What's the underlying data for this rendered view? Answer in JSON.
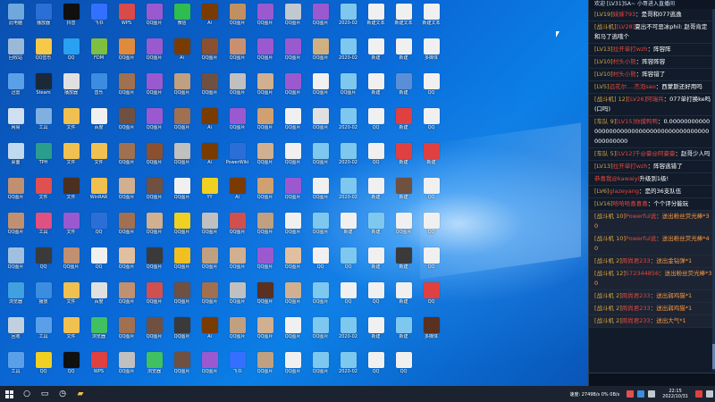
{
  "desktop": {
    "icons": [
      {
        "label": "此电脑",
        "color": "#6fa8dc"
      },
      {
        "label": "播放器",
        "color": "#2b6fd6"
      },
      {
        "label": "抖音",
        "color": "#101010"
      },
      {
        "label": "飞书",
        "color": "#3370ff"
      },
      {
        "label": "WPS",
        "color": "#d94a4a"
      },
      {
        "label": "QQ图片",
        "color": "#9b59d0"
      },
      {
        "label": "微信",
        "color": "#2ebd4e"
      },
      {
        "label": "Ai",
        "color": "#7a3b00"
      },
      {
        "label": "QQ图片",
        "color": "#c09060"
      },
      {
        "label": "QQ图片",
        "color": "#9b59d0"
      },
      {
        "label": "QQ图片",
        "color": "#c0c8d0"
      },
      {
        "label": "QQ图片",
        "color": "#9b59d0"
      },
      {
        "label": "2020-02",
        "color": "#7ec8f0"
      },
      {
        "label": "新建文本",
        "color": "#f0f0f0"
      },
      {
        "label": "新建文本",
        "color": "#f0f0f0"
      },
      {
        "label": "新建文本",
        "color": "#f0f0f0"
      },
      {
        "label": "",
        "color": "#0a6ad8"
      },
      {
        "label": "回收站",
        "color": "#9ab8d8"
      },
      {
        "label": "QQ音乐",
        "color": "#f7c948"
      },
      {
        "label": "QQ",
        "color": "#2aa1f0"
      },
      {
        "label": "FDM",
        "color": "#7fbf3f"
      },
      {
        "label": "QQ图片",
        "color": "#e08a3c"
      },
      {
        "label": "QQ图片",
        "color": "#9b59d0"
      },
      {
        "label": "Ai",
        "color": "#7a3b00"
      },
      {
        "label": "QQ图片",
        "color": "#8a5030"
      },
      {
        "label": "QQ图片",
        "color": "#c89070"
      },
      {
        "label": "QQ图片",
        "color": "#9b59d0"
      },
      {
        "label": "QQ图片",
        "color": "#9b59d0"
      },
      {
        "label": "QQ图片",
        "color": "#d0b080"
      },
      {
        "label": "2020-02",
        "color": "#7ec8f0"
      },
      {
        "label": "新建",
        "color": "#f0f0f0"
      },
      {
        "label": "新建",
        "color": "#f0f0f0"
      },
      {
        "label": "多媒体",
        "color": "#f0f0f0"
      },
      {
        "label": "",
        "color": "#0a6ad8"
      },
      {
        "label": "迅雷",
        "color": "#5aa0e8"
      },
      {
        "label": "Steam",
        "color": "#1b2838"
      },
      {
        "label": "播放器",
        "color": "#e0e0e0"
      },
      {
        "label": "音乐",
        "color": "#3a8de0"
      },
      {
        "label": "QQ图片",
        "color": "#a07050"
      },
      {
        "label": "QQ图片",
        "color": "#9b59d0"
      },
      {
        "label": "QQ图片",
        "color": "#c0a080"
      },
      {
        "label": "QQ图片",
        "color": "#705040"
      },
      {
        "label": "QQ图片",
        "color": "#c0c0c0"
      },
      {
        "label": "QQ图片",
        "color": "#d0b090"
      },
      {
        "label": "QQ图片",
        "color": "#9b59d0"
      },
      {
        "label": "QQ图片",
        "color": "#f0f0f0"
      },
      {
        "label": "QQ图片",
        "color": "#7ec8f0"
      },
      {
        "label": "新建",
        "color": "#f0f0f0"
      },
      {
        "label": "新建",
        "color": "#5a8fd8"
      },
      {
        "label": "QQ",
        "color": "#f0f0f0"
      },
      {
        "label": "",
        "color": "#0a6ad8"
      },
      {
        "label": "网易",
        "color": "#d0e0f0"
      },
      {
        "label": "工具",
        "color": "#7fb0e0"
      },
      {
        "label": "文件",
        "color": "#f0c050"
      },
      {
        "label": "百度",
        "color": "#f0f0f0"
      },
      {
        "label": "QQ图片",
        "color": "#705040"
      },
      {
        "label": "QQ图片",
        "color": "#9b59d0"
      },
      {
        "label": "QQ图片",
        "color": "#a07050"
      },
      {
        "label": "Ai",
        "color": "#7a3b00"
      },
      {
        "label": "QQ图片",
        "color": "#9b59d0"
      },
      {
        "label": "QQ图片",
        "color": "#d0a070"
      },
      {
        "label": "QQ图片",
        "color": "#f0f0f0"
      },
      {
        "label": "QQ图片",
        "color": "#e0e0e0"
      },
      {
        "label": "2020-02",
        "color": "#7ec8f0"
      },
      {
        "label": "QQ",
        "color": "#f0f0f0"
      },
      {
        "label": "新建",
        "color": "#e04040"
      },
      {
        "label": "QQ",
        "color": "#f0f0f0"
      },
      {
        "label": "",
        "color": "#0a6ad8"
      },
      {
        "label": "桌面",
        "color": "#c0d8f0"
      },
      {
        "label": "TPH",
        "color": "#2a9d8f"
      },
      {
        "label": "文件",
        "color": "#f0c050"
      },
      {
        "label": "文件",
        "color": "#f0c050"
      },
      {
        "label": "QQ图片",
        "color": "#a07050"
      },
      {
        "label": "QQ图片",
        "color": "#8a5030"
      },
      {
        "label": "QQ图片",
        "color": "#c0c0c0"
      },
      {
        "label": "Ai",
        "color": "#7a3b00"
      },
      {
        "label": "PowerWiki",
        "color": "#2b6fd6"
      },
      {
        "label": "QQ图片",
        "color": "#d0b090"
      },
      {
        "label": "QQ图片",
        "color": "#f0f0f0"
      },
      {
        "label": "QQ图片",
        "color": "#7ec8f0"
      },
      {
        "label": "2020-02",
        "color": "#7ec8f0"
      },
      {
        "label": "QQ",
        "color": "#f0f0f0"
      },
      {
        "label": "新建",
        "color": "#e04040"
      },
      {
        "label": "新建",
        "color": "#e04040"
      },
      {
        "label": "",
        "color": "#0a6ad8"
      },
      {
        "label": "QQ图片",
        "color": "#c09070"
      },
      {
        "label": "文件",
        "color": "#e05050"
      },
      {
        "label": "文件",
        "color": "#4a3020"
      },
      {
        "label": "WinRAR",
        "color": "#f0c050"
      },
      {
        "label": "QQ图片",
        "color": "#d0b090"
      },
      {
        "label": "QQ图片",
        "color": "#705040"
      },
      {
        "label": "QQ图片",
        "color": "#f0f0f0"
      },
      {
        "label": "YY",
        "color": "#f0d020"
      },
      {
        "label": "Ai",
        "color": "#7a3b00"
      },
      {
        "label": "QQ图片",
        "color": "#d0a070"
      },
      {
        "label": "QQ图片",
        "color": "#9b59d0"
      },
      {
        "label": "QQ图片",
        "color": "#f0f0f0"
      },
      {
        "label": "2020-02",
        "color": "#7ec8f0"
      },
      {
        "label": "新建",
        "color": "#f0f0f0"
      },
      {
        "label": "新建",
        "color": "#705040"
      },
      {
        "label": "QQ",
        "color": "#f0f0f0"
      },
      {
        "label": "",
        "color": "#0a6ad8"
      },
      {
        "label": "QQ图片",
        "color": "#c09070"
      },
      {
        "label": "工具",
        "color": "#e05080"
      },
      {
        "label": "文件",
        "color": "#9b59d0"
      },
      {
        "label": "QQ",
        "color": "#2b6fd6"
      },
      {
        "label": "QQ图片",
        "color": "#a07050"
      },
      {
        "label": "QQ图片",
        "color": "#d0b090"
      },
      {
        "label": "QQ图片",
        "color": "#f0d020"
      },
      {
        "label": "QQ图片",
        "color": "#c0c0c0"
      },
      {
        "label": "QQ图片",
        "color": "#d05050"
      },
      {
        "label": "QQ图片",
        "color": "#c0a080"
      },
      {
        "label": "QQ图片",
        "color": "#f0f0f0"
      },
      {
        "label": "QQ图片",
        "color": "#7ec8f0"
      },
      {
        "label": "新建",
        "color": "#f0f0f0"
      },
      {
        "label": "新建",
        "color": "#7ec8f0"
      },
      {
        "label": "QQ图片",
        "color": "#f0f0f0"
      },
      {
        "label": "QQ",
        "color": "#f0f0f0"
      },
      {
        "label": "",
        "color": "#0a6ad8"
      },
      {
        "label": "QQ图片",
        "color": "#a0c0e0"
      },
      {
        "label": "QQ",
        "color": "#3a3a3a"
      },
      {
        "label": "QQ图片",
        "color": "#c09070"
      },
      {
        "label": "QQ",
        "color": "#f0f0f0"
      },
      {
        "label": "QQ图片",
        "color": "#e0c0a0"
      },
      {
        "label": "QQ图片",
        "color": "#3a3a3a"
      },
      {
        "label": "QQ图片",
        "color": "#f0c020"
      },
      {
        "label": "QQ图片",
        "color": "#c0a080"
      },
      {
        "label": "QQ图片",
        "color": "#d0b090"
      },
      {
        "label": "QQ图片",
        "color": "#9b59d0"
      },
      {
        "label": "QQ图片",
        "color": "#e0c0a0"
      },
      {
        "label": "QQ",
        "color": "#f0f0f0"
      },
      {
        "label": "QQ",
        "color": "#7ec8f0"
      },
      {
        "label": "新建",
        "color": "#f0f0f0"
      },
      {
        "label": "新建",
        "color": "#3a3a3a"
      },
      {
        "label": "QQ",
        "color": "#f0f0f0"
      },
      {
        "label": "",
        "color": "#0a6ad8"
      },
      {
        "label": "浏览器",
        "color": "#40a0e0"
      },
      {
        "label": "播放",
        "color": "#3a8de0"
      },
      {
        "label": "文件",
        "color": "#f0c050"
      },
      {
        "label": "百度",
        "color": "#e0e0e0"
      },
      {
        "label": "QQ图片",
        "color": "#c09070"
      },
      {
        "label": "QQ图片",
        "color": "#d05050"
      },
      {
        "label": "QQ图片",
        "color": "#705040"
      },
      {
        "label": "QQ图片",
        "color": "#a07050"
      },
      {
        "label": "QQ图片",
        "color": "#c0c0c0"
      },
      {
        "label": "QQ图片",
        "color": "#5a3020"
      },
      {
        "label": "QQ图片",
        "color": "#d0b090"
      },
      {
        "label": "QQ图片",
        "color": "#7ec8f0"
      },
      {
        "label": "QQ",
        "color": "#f0f0f0"
      },
      {
        "label": "QQ",
        "color": "#f0f0f0"
      },
      {
        "label": "新建",
        "color": "#f0f0f0"
      },
      {
        "label": "QQ",
        "color": "#e04040"
      },
      {
        "label": "",
        "color": "#0a6ad8"
      },
      {
        "label": "回收",
        "color": "#c0d0e0"
      },
      {
        "label": "工具",
        "color": "#5aa0e8"
      },
      {
        "label": "文件",
        "color": "#f0c050"
      },
      {
        "label": "浏览器",
        "color": "#40c060"
      },
      {
        "label": "QQ图片",
        "color": "#a07050"
      },
      {
        "label": "QQ图片",
        "color": "#705040"
      },
      {
        "label": "QQ图片",
        "color": "#3a3a3a"
      },
      {
        "label": "Ai",
        "color": "#7a3b00"
      },
      {
        "label": "QQ图片",
        "color": "#c0a080"
      },
      {
        "label": "QQ图片",
        "color": "#d0b090"
      },
      {
        "label": "QQ图片",
        "color": "#f0f0f0"
      },
      {
        "label": "QQ图片",
        "color": "#7ec8f0"
      },
      {
        "label": "2020-02",
        "color": "#7ec8f0"
      },
      {
        "label": "新建",
        "color": "#f0f0f0"
      },
      {
        "label": "新建",
        "color": "#7ec8f0"
      },
      {
        "label": "多媒体",
        "color": "#5a3020"
      },
      {
        "label": "",
        "color": "#0a6ad8"
      },
      {
        "label": "工具",
        "color": "#5aa0e8"
      },
      {
        "label": "QQ",
        "color": "#f0d020"
      },
      {
        "label": "QQ",
        "color": "#101010"
      },
      {
        "label": "WPS",
        "color": "#e04040"
      },
      {
        "label": "QQ图片",
        "color": "#c0c0c0"
      },
      {
        "label": "浏览器",
        "color": "#40c060"
      },
      {
        "label": "QQ图片",
        "color": "#705040"
      },
      {
        "label": "QQ图片",
        "color": "#9b59d0"
      },
      {
        "label": "飞书",
        "color": "#3370ff"
      },
      {
        "label": "QQ图片",
        "color": "#c0a080"
      },
      {
        "label": "QQ图片",
        "color": "#f0f0f0"
      },
      {
        "label": "QQ图片",
        "color": "#7ec8f0"
      },
      {
        "label": "2020-02",
        "color": "#7ec8f0"
      },
      {
        "label": "QQ",
        "color": "#f0f0f0"
      },
      {
        "label": "QQ",
        "color": "#f0f0f0"
      },
      {
        "label": "",
        "color": "#0a6ad8"
      },
      {
        "label": "",
        "color": "#0a6ad8"
      }
    ]
  },
  "chat": {
    "header": "欢迎 [LV31]SA~ 小哥进入直播间",
    "messages": [
      {
        "lvl": "[LV19]",
        "name": "妹妹793",
        "text": "：是哥和077逃逸",
        "type": "normal"
      },
      {
        "lvl": "[战斗机]",
        "name": "[LV28]",
        "text": "夏出不可恶冰phil: 赵哥肯定和马了逃哦个",
        "type": "normal"
      },
      {
        "lvl": "[LV13]",
        "name": "拉开单打wzh",
        "text": "：阵容阵",
        "type": "normal"
      },
      {
        "lvl": "[LV10]",
        "name": "村头小熊",
        "text": "：阵容阵容",
        "type": "normal"
      },
      {
        "lvl": "[LV10]",
        "name": "村头小熊",
        "text": "：阵容错了",
        "type": "normal"
      },
      {
        "lvl": "[LV5]",
        "name": "远花尔....杰泡sao",
        "text": "：西蒙斯还好用吗",
        "type": "normal"
      },
      {
        "lvl": "[战斗机] 12]",
        "name": "[LV26]阿瑞兵",
        "text": "：077单打换ke吗(口吗)",
        "type": "normal"
      },
      {
        "lvl": "[车队 9]",
        "name": "[LV15]你摸鸭鸭",
        "text": "：0.000000000000000000000000000000000000000000000000000",
        "type": "normal"
      },
      {
        "lvl": "[车队 5]",
        "name": "[LV12]千@豪@阿豪豪",
        "text": "：赵哥少人吗",
        "type": "normal"
      },
      {
        "lvl": "[LV13]",
        "name": "拉开单打wzh",
        "text": "：阵容逃错了",
        "type": "normal"
      },
      {
        "lvl": "",
        "name": "恭喜我@kawaiyi",
        "text": "升级到1级!",
        "type": "normal"
      },
      {
        "lvl": "[LV6]",
        "name": "glazeyang",
        "text": "：是的36支队伍",
        "type": "normal"
      },
      {
        "lvl": "[LV16]",
        "name": "哈哈哈喜喜喜",
        "text": "：个个评分能玩",
        "type": "normal"
      },
      {
        "lvl": "[战斗机 10]",
        "name": "Powerful说",
        "text": "：送出粉丝荧光棒*30",
        "type": "gift"
      },
      {
        "lvl": "[战斗机 10]",
        "name": "Powerful说",
        "text": "：送出粉丝荧光棒*40",
        "type": "gift"
      },
      {
        "lvl": "[战斗机 2]",
        "name": "周尚君233",
        "text": "：送出金钻弹*1",
        "type": "gift"
      },
      {
        "lvl": "[战斗机 12]",
        "name": "572344856",
        "text": "：送出粉丝荧光棒*30",
        "type": "gift"
      },
      {
        "lvl": "[战斗机 2]",
        "name": "周尚君233",
        "text": "：送出弱鸡猫*1",
        "type": "gift"
      },
      {
        "lvl": "[战斗机 2]",
        "name": "周尚君233",
        "text": "：送出弱鸡猫*1",
        "type": "gift"
      },
      {
        "lvl": "[战斗机 2]",
        "name": "周尚君233",
        "text": "：送出大气*1",
        "type": "gift"
      }
    ]
  },
  "taskbar": {
    "clock_time": "22:15",
    "clock_date": "2022/10/31",
    "tray_status": "速度: 2749B/s 0% 0B/s"
  }
}
